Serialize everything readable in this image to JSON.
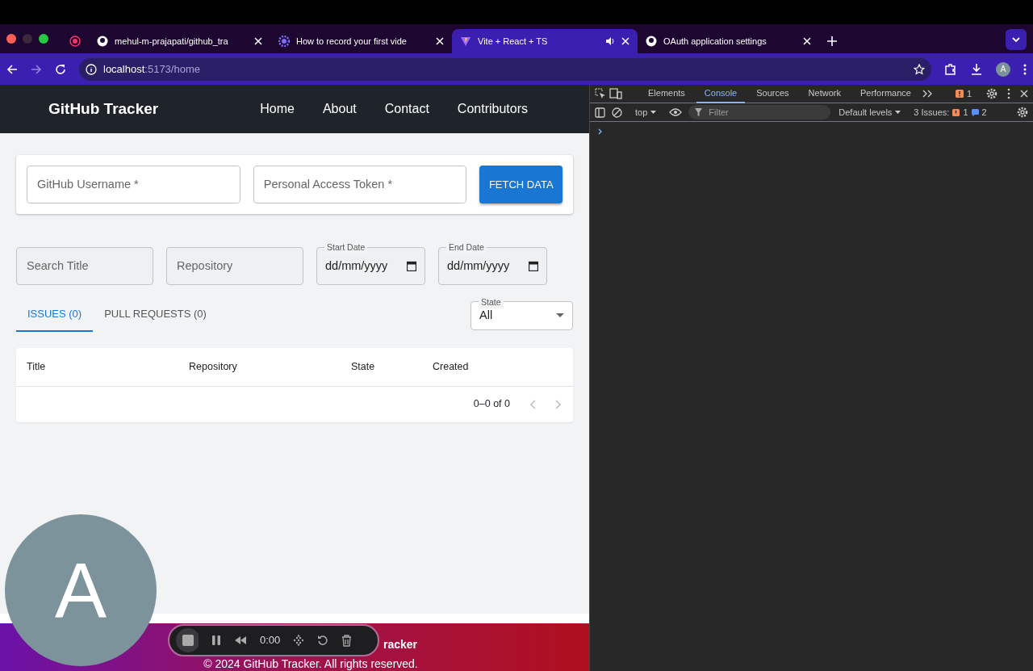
{
  "browser": {
    "tabs": [
      {
        "kind": "record",
        "selected": false
      },
      {
        "kind": "github",
        "title": "mehul-m-prajapati/github_tra",
        "selected": false
      },
      {
        "kind": "gear",
        "title": "How to record your first vide",
        "selected": false
      },
      {
        "kind": "vite",
        "title": "Vite + React + TS",
        "selected": true,
        "audio": true
      },
      {
        "kind": "github",
        "title": "OAuth application settings",
        "selected": false
      }
    ],
    "address": {
      "host": "localhost",
      "path": ":5173/home"
    },
    "profile": "A"
  },
  "devtools": {
    "tabs": [
      {
        "label": "Elements",
        "selected": false
      },
      {
        "label": "Console",
        "selected": true
      },
      {
        "label": "Sources",
        "selected": false
      },
      {
        "label": "Network",
        "selected": false
      },
      {
        "label": "Performance",
        "selected": false
      }
    ],
    "error_count": "1",
    "context": "top",
    "filter_placeholder": "Filter",
    "levels": "Default levels",
    "issues_label": "3 Issues:",
    "issues_errors": "1",
    "issues_info": "2"
  },
  "app": {
    "brand": "GitHub Tracker",
    "nav": [
      "Home",
      "About",
      "Contact",
      "Contributors"
    ],
    "credentials": [
      {
        "label": "GitHub Username *"
      },
      {
        "label": "Personal Access Token *"
      }
    ],
    "fetch_button": "FETCH DATA",
    "filters": [
      {
        "kind": "text",
        "placeholder": "Search Title"
      },
      {
        "kind": "text",
        "placeholder": "Repository"
      },
      {
        "kind": "date",
        "label": "Start Date",
        "value": "dd/mm/yyyy"
      },
      {
        "kind": "date",
        "label": "End Date",
        "value": "dd/mm/yyyy"
      }
    ],
    "tabs": [
      {
        "label": "ISSUES (0)",
        "selected": true
      },
      {
        "label": "PULL REQUESTS (0)",
        "selected": false
      }
    ],
    "state_select": {
      "label": "State",
      "value": "All"
    },
    "table": {
      "columns": [
        "Title",
        "Repository",
        "State",
        "Created"
      ],
      "pagination": "0–0 of 0"
    },
    "footer": {
      "title": "racker",
      "copyright": "© 2024 GitHub Tracker. All rights reserved."
    }
  },
  "overlay": {
    "avatar": "A",
    "recorder_time": "0:00"
  }
}
